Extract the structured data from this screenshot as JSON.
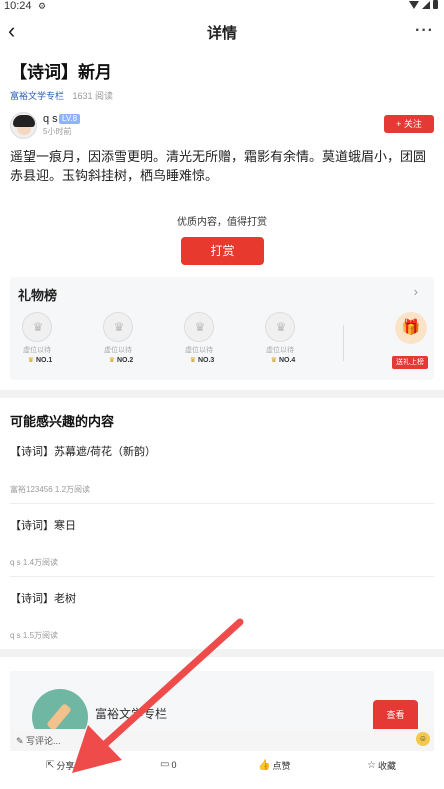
{
  "status": {
    "time": "10:24",
    "gear": "⚙"
  },
  "nav": {
    "back": "‹",
    "title": "详情",
    "more": "···"
  },
  "article": {
    "title": "【诗词】新月",
    "column": "富裕文学专栏",
    "reads": "1631 阅读",
    "author": {
      "name": "q s",
      "level": "LV.8",
      "time_ago": "5小时前",
      "follow_label": "+ 关注"
    },
    "body": "遥望一痕月，因添雪更明。清光无所赠，霜影有余情。莫道蛾眉小，团圆赤县迎。玉钩斜挂树，栖鸟睡难惊。"
  },
  "tip": {
    "caption": "优质内容，值得打赏",
    "button": "打赏"
  },
  "gifts": {
    "title": "礼物榜",
    "chevron": "›",
    "slots": [
      {
        "vacant": "虚位以待",
        "rank": "NO.1"
      },
      {
        "vacant": "虚位以待",
        "rank": "NO.2"
      },
      {
        "vacant": "虚位以待",
        "rank": "NO.3"
      },
      {
        "vacant": "虚位以待",
        "rank": "NO.4"
      }
    ],
    "send_label": "送礼上榜",
    "crown": "♛",
    "gift_icon": "🎁"
  },
  "recommend": {
    "header": "可能感兴趣的内容",
    "items": [
      {
        "title": "【诗词】苏幕遮/荷花（新韵）",
        "meta": "富裕123456   1.2万阅读"
      },
      {
        "title": "【诗词】寒日",
        "meta": "q s   1.4万阅读"
      },
      {
        "title": "【诗词】老树",
        "meta": "q s   1.5万阅读"
      }
    ]
  },
  "column_card": {
    "name": "富裕文学专栏",
    "view_label": "查看"
  },
  "comment": {
    "placeholder": "✎ 写评论...",
    "emoji": "☺"
  },
  "actions": [
    {
      "icon": "⇱",
      "label": "分享"
    },
    {
      "icon": "▭",
      "label": "0"
    },
    {
      "icon": "👍",
      "label": "点赞"
    },
    {
      "icon": "☆",
      "label": "收藏"
    }
  ],
  "colors": {
    "accent": "#e53935",
    "link": "#2a5bb8",
    "annotation_arrow": "#ef4b4b"
  }
}
